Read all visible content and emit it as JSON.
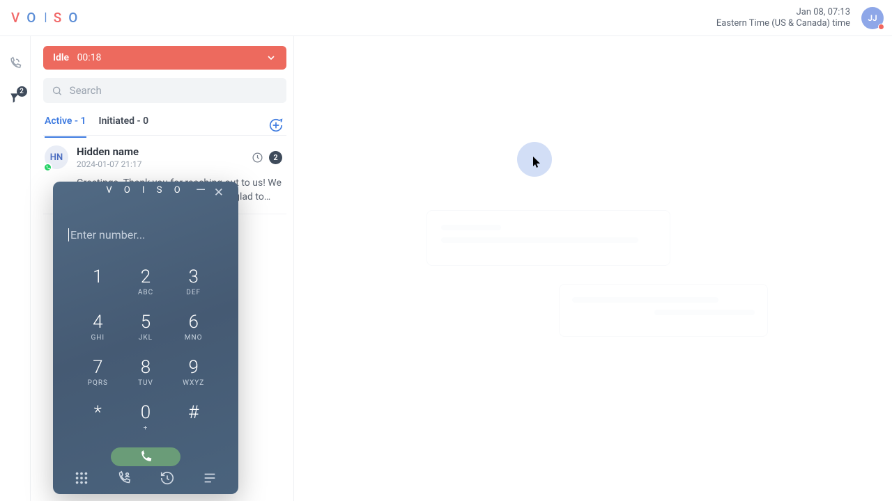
{
  "header": {
    "logo_letters": [
      "V",
      "O",
      "I",
      "S",
      "O"
    ],
    "datetime": "Jan 08, 07:13",
    "timezone": "Eastern Time (US & Canada) time",
    "avatar_initials": "JJ"
  },
  "leftnav": {
    "badge": "2"
  },
  "status": {
    "label": "Idle",
    "elapsed": "00:18"
  },
  "search": {
    "placeholder": "Search"
  },
  "tabs": {
    "active": "Active - 1",
    "initiated": "Initiated - 0"
  },
  "conversation": {
    "avatar_initials": "HN",
    "name": "Hidden name",
    "timestamp": "2024-01-07 21:17",
    "unread": "2",
    "preview": "Greetings. Thank you for reaching out to us! We appreciate your patience and will be glad to provide…"
  },
  "dialer": {
    "placeholder": "Enter number...",
    "keys": [
      {
        "d": "1",
        "l": ""
      },
      {
        "d": "2",
        "l": "ABC"
      },
      {
        "d": "3",
        "l": "DEF"
      },
      {
        "d": "4",
        "l": "GHI"
      },
      {
        "d": "5",
        "l": "JKL"
      },
      {
        "d": "6",
        "l": "MNO"
      },
      {
        "d": "7",
        "l": "PQRS"
      },
      {
        "d": "8",
        "l": "TUV"
      },
      {
        "d": "9",
        "l": "WXYZ"
      },
      {
        "d": "*",
        "l": ""
      },
      {
        "d": "0",
        "l": "+"
      },
      {
        "d": "#",
        "l": ""
      }
    ]
  }
}
